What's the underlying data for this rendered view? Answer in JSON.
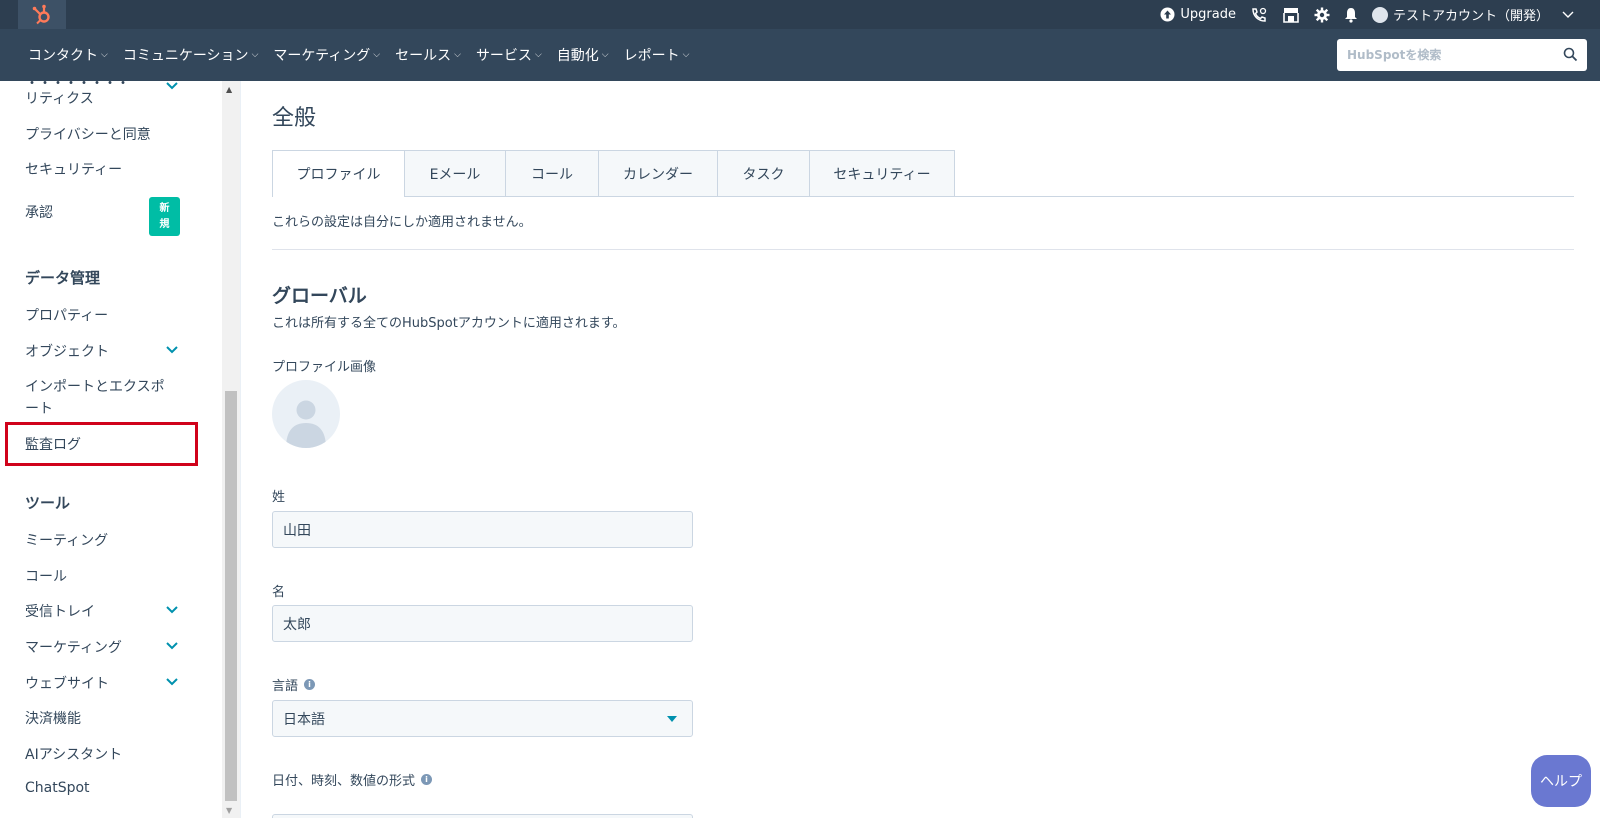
{
  "topbar": {
    "upgrade_label": "Upgrade",
    "account_label": "テストアカウント（開発）",
    "colors": {
      "bg": "#2d3e50",
      "logo": "#ff7a59"
    }
  },
  "nav": {
    "items": [
      "コンタクト",
      "コミュニケーション",
      "マーケティング",
      "セールス",
      "サービス",
      "自動化",
      "レポート"
    ],
    "search_placeholder": "HubSpotを検索"
  },
  "sidebar": {
    "partial_item": "リティクス",
    "privacy": "プライバシーと同意",
    "security": "セキュリティー",
    "approval": "承認",
    "badge": [
      "新",
      "規"
    ],
    "data_header": "データ管理",
    "properties": "プロパティー",
    "objects": "オブジェクト",
    "import_export": "インポートとエクスポート",
    "audit_log": "監査ログ",
    "tools_header": "ツール",
    "meetings": "ミーティング",
    "calls": "コール",
    "inbox": "受信トレイ",
    "marketing": "マーケティング",
    "website": "ウェブサイト",
    "payments": "決済機能",
    "ai_assistant": "AIアシスタント",
    "chatspot": "ChatSpot",
    "colors": {
      "badge": "#00bda5",
      "highlight": "#d0021b"
    }
  },
  "main": {
    "title": "全般",
    "tabs": [
      "プロファイル",
      "Eメール",
      "コール",
      "カレンダー",
      "タスク",
      "セキュリティー"
    ],
    "active_tab": "プロファイル",
    "note": "これらの設定は自分にしか適用されません。",
    "section_title": "グローバル",
    "section_sub": "これは所有する全てのHubSpotアカウントに適用されます。",
    "profile_image_label": "プロファイル画像",
    "last_name_label": "姓",
    "last_name_value": "山田",
    "first_name_label": "名",
    "first_name_value": "太郎",
    "language_label": "言語",
    "language_value": "日本語",
    "date_format_label": "日付、時刻、数値の形式"
  },
  "help": {
    "label": "ヘルプ",
    "color": "#6a78d1"
  }
}
